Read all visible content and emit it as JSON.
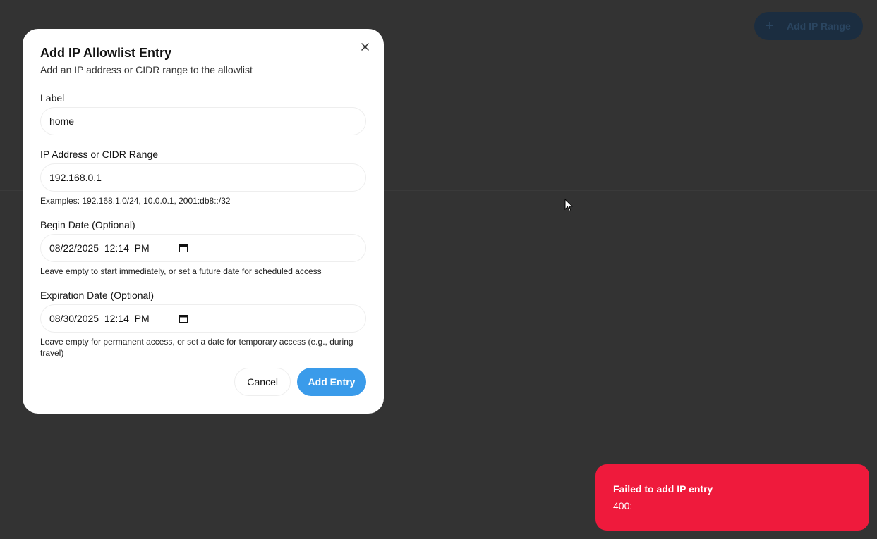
{
  "background": {
    "add_button_label": "Add IP Range",
    "add_button_icon": "plus-icon"
  },
  "modal": {
    "title": "Add IP Allowlist Entry",
    "subtitle": "Add an IP address or CIDR range to the allowlist",
    "close_icon": "close-icon",
    "fields": {
      "label": {
        "label": "Label",
        "value": "home"
      },
      "ip": {
        "label": "IP Address or CIDR Range",
        "value": "192.168.0.1",
        "help": "Examples: 192.168.1.0/24, 10.0.0.1, 2001:db8::/32"
      },
      "begin": {
        "label": "Begin Date (Optional)",
        "value": "08/22/2025  12:14  PM",
        "help": "Leave empty to start immediately, or set a future date for scheduled access"
      },
      "expiration": {
        "label": "Expiration Date (Optional)",
        "value": "08/30/2025  12:14  PM",
        "help": "Leave empty for permanent access, or set a date for temporary access (e.g., during travel)"
      }
    },
    "cancel_label": "Cancel",
    "submit_label": "Add Entry"
  },
  "toast": {
    "title": "Failed to add IP entry",
    "message": "400:",
    "color": "#ef1a3c"
  },
  "colors": {
    "accent": "#3a9bea",
    "backdrop": "#333333"
  }
}
